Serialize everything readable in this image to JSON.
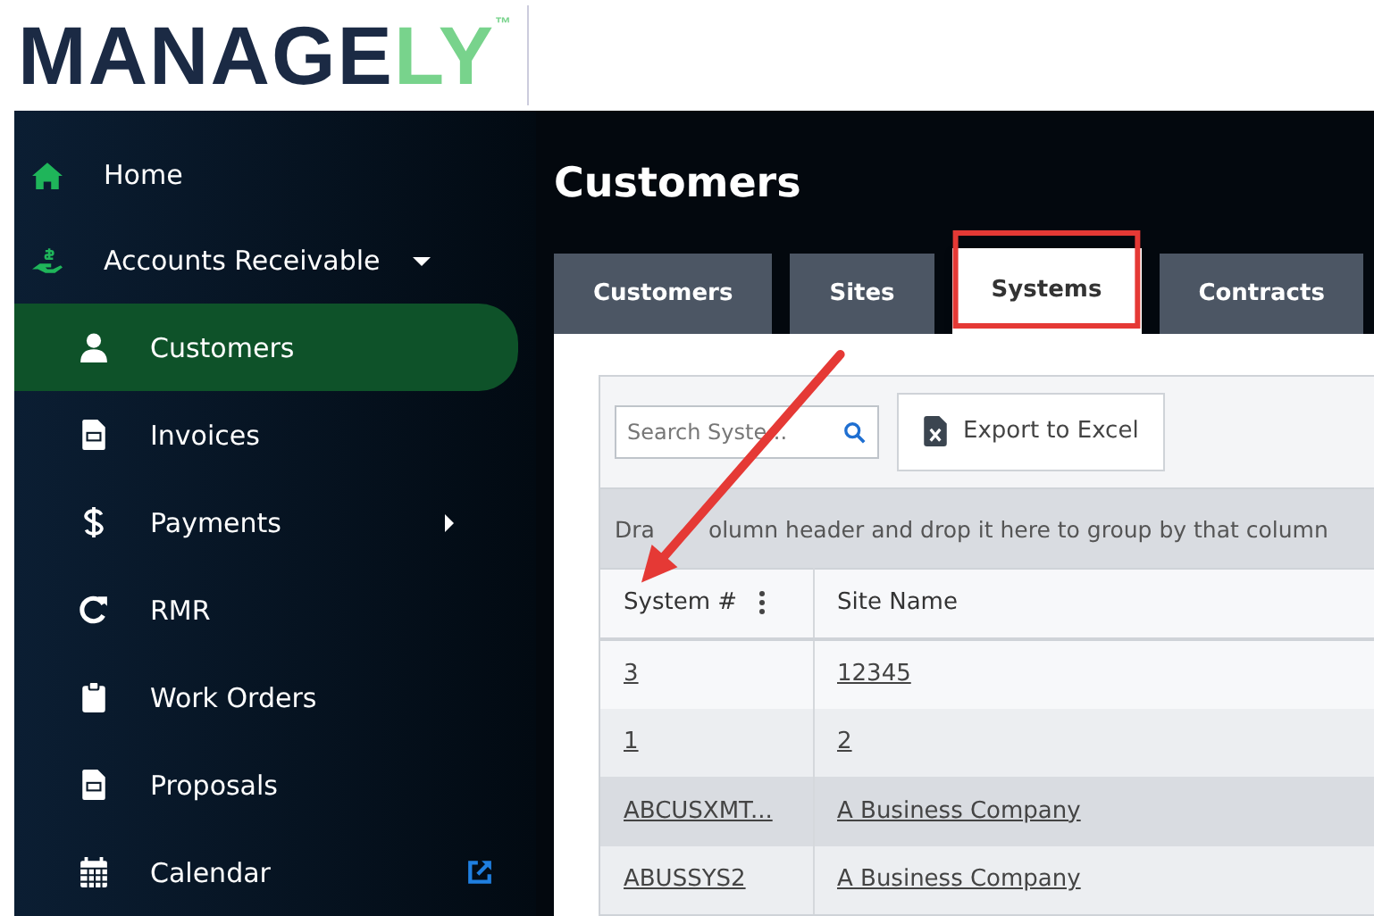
{
  "brand": {
    "logo_main": "MANAGE",
    "logo_accent": "LY",
    "trademark": "™"
  },
  "sidebar": {
    "items": [
      {
        "label": "Home",
        "kind": "home",
        "selected": false
      },
      {
        "label": "Accounts Receivable",
        "kind": "money",
        "expanded": true,
        "selected": false,
        "children": [
          {
            "label": "Customers",
            "kind": "person",
            "selected": true
          },
          {
            "label": "Invoices",
            "kind": "document",
            "selected": false
          },
          {
            "label": "Payments",
            "kind": "dollar",
            "selected": false,
            "has_submenu": true
          },
          {
            "label": "RMR",
            "kind": "refresh",
            "selected": false
          },
          {
            "label": "Work Orders",
            "kind": "clipboard",
            "selected": false
          },
          {
            "label": "Proposals",
            "kind": "document",
            "selected": false
          },
          {
            "label": "Calendar",
            "kind": "calendar",
            "selected": false,
            "external": true
          }
        ]
      }
    ]
  },
  "page": {
    "title": "Customers"
  },
  "tabs": [
    {
      "label": "Customers",
      "selected": false,
      "highlighted": false
    },
    {
      "label": "Sites",
      "selected": false,
      "highlighted": false
    },
    {
      "label": "Systems",
      "selected": true,
      "highlighted": true
    },
    {
      "label": "Contracts",
      "selected": false,
      "highlighted": false
    }
  ],
  "toolbar": {
    "search": {
      "placeholder": "Search Syste..."
    },
    "export_button": "Export to Excel"
  },
  "grid": {
    "group_hint": [
      "Dra",
      "olumn header and drop it here to group by that column"
    ],
    "columns": [
      {
        "label": "System #",
        "menu": true,
        "arrow_target": true
      },
      {
        "label": "Site Name"
      }
    ],
    "rows": [
      [
        "3",
        "12345"
      ],
      [
        "1",
        "2"
      ],
      [
        "ABCUSXMT...",
        "A Business Company"
      ],
      [
        "ABUSSYS2",
        "A Business Company"
      ]
    ]
  }
}
